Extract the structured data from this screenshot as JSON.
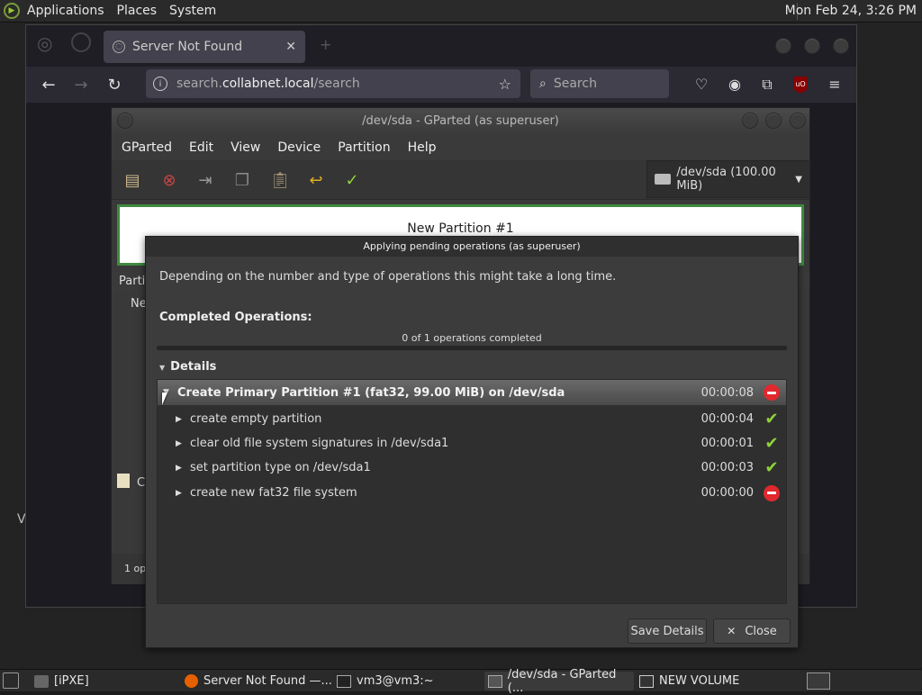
{
  "top_panel": {
    "menus": [
      "Applications",
      "Places",
      "System"
    ],
    "clock": "Mon Feb 24,  3:26 PM"
  },
  "desktop": {
    "partial_label": "V"
  },
  "firefox": {
    "tab_title": "Server Not Found",
    "tab_close": "✕",
    "url_prefix": "search.",
    "url_host": "collabnet.local",
    "url_path": "/search",
    "search_placeholder": "Search"
  },
  "gparted": {
    "title": "/dev/sda - GParted (as superuser)",
    "menu": [
      "GParted",
      "Edit",
      "View",
      "Device",
      "Partition",
      "Help"
    ],
    "device": "/dev/sda (100.00 MiB)",
    "partition_label": "New Partition #1",
    "list_header_partial": "Partit",
    "list_row_partial": "Ne",
    "pending_partial": "C",
    "status_partial": "1 ope"
  },
  "dialog": {
    "title": "Applying pending operations (as superuser)",
    "description": "Depending on the number and type of operations this might take a long time.",
    "completed_label": "Completed Operations:",
    "progress_text": "0 of 1 operations completed",
    "progress_fraction": 0,
    "details_label": "Details",
    "operations": [
      {
        "text": "Create Primary Partition #1 (fat32, 99.00 MiB) on /dev/sda",
        "time": "00:00:08",
        "status": "error",
        "header": true
      },
      {
        "text": "create empty partition",
        "time": "00:00:04",
        "status": "ok"
      },
      {
        "text": "clear old file system signatures in /dev/sda1",
        "time": "00:00:01",
        "status": "ok"
      },
      {
        "text": "set partition type on /dev/sda1",
        "time": "00:00:03",
        "status": "ok"
      },
      {
        "text": "create new fat32 file system",
        "time": "00:00:00",
        "status": "error"
      }
    ],
    "save_button": "Save Details",
    "close_button": "Close"
  },
  "taskbar": {
    "items": [
      "[iPXE]",
      "Server Not Found —...",
      "vm3@vm3:~",
      "/dev/sda - GParted (...",
      "NEW VOLUME"
    ]
  },
  "colors": {
    "accent_green": "#8fd23a",
    "error_red": "#e0282d",
    "partition_border": "#3f8a3f"
  }
}
